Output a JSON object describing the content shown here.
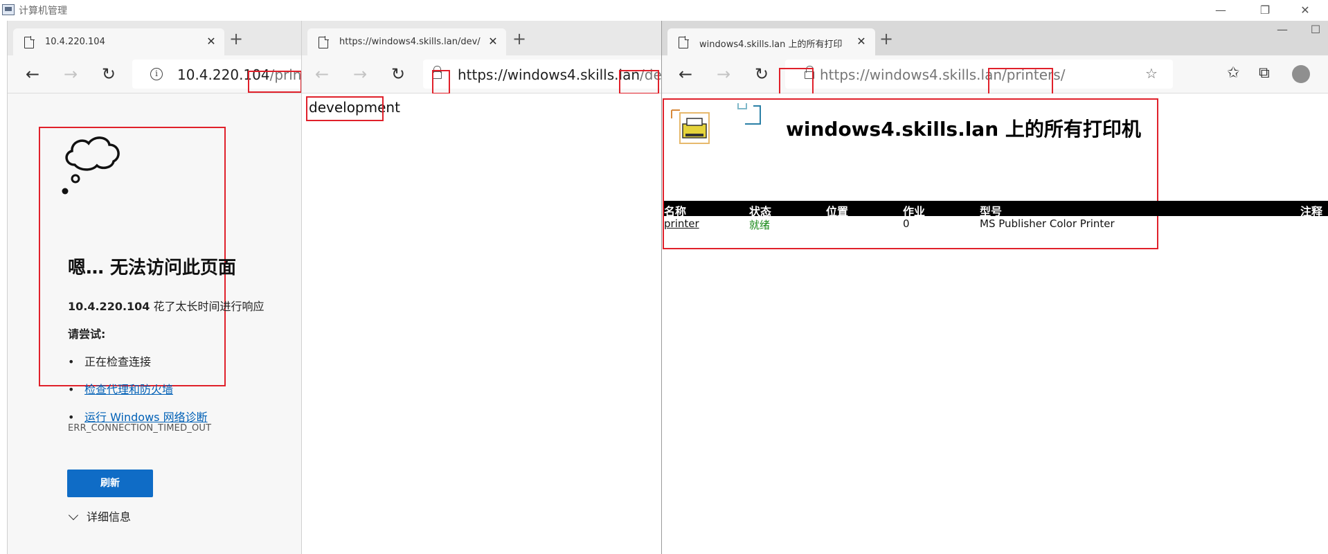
{
  "host": {
    "title": "计算机管理",
    "controls": {
      "minimize": "—",
      "restore": "❐",
      "close": "✕"
    }
  },
  "pane1": {
    "tab_title": "10.4.220.104",
    "new_tab": "+",
    "address": {
      "host": "10.4.220.104",
      "path": "/printers"
    },
    "error": {
      "title": "嗯… 无法访问此页面",
      "host": "10.4.220.104",
      "message": " 花了太长时间进行响应",
      "try_label": "请尝试:",
      "suggestions": [
        "正在检查连接",
        "检查代理和防火墙",
        "运行 Windows 网络诊断"
      ],
      "code": "ERR_CONNECTION_TIMED_OUT",
      "refresh_label": "刷新",
      "details_label": "详细信息"
    }
  },
  "pane2": {
    "tab_title": "https://windows4.skills.lan/dev/",
    "new_tab": "+",
    "address": {
      "host": "https://windows4.skills.lan",
      "path": "/dev/"
    },
    "body_text": "development"
  },
  "pane3": {
    "tab_title": "windows4.skills.lan 上的所有打印",
    "new_tab": "+",
    "address": {
      "host": "https://windows4.skills.lan",
      "path": "/printers/"
    },
    "window_controls": {
      "minimize": "—",
      "maximize": "☐"
    },
    "heading": "windows4.skills.lan 上的所有打印机",
    "table": {
      "columns": [
        "名称",
        "状态",
        "位置",
        "作业",
        "型号",
        "注释"
      ],
      "rows": [
        {
          "name": "printer",
          "status": "就绪",
          "location": "",
          "jobs": "0",
          "model": "MS Publisher Color Printer",
          "comment": ""
        }
      ]
    }
  },
  "colors": {
    "highlight_box": "#e0202a",
    "link": "#0060b6",
    "refresh_button": "#0f6cc6",
    "status_ok": "#1a8a1a"
  },
  "icons": [
    "page-icon",
    "close-icon",
    "plus-icon",
    "back-arrow-icon",
    "forward-arrow-icon",
    "refresh-icon",
    "info-icon",
    "lock-icon",
    "star-icon",
    "favorites-icon",
    "collections-icon",
    "profile-icon",
    "cloud-icon",
    "printer-folder-icon"
  ]
}
